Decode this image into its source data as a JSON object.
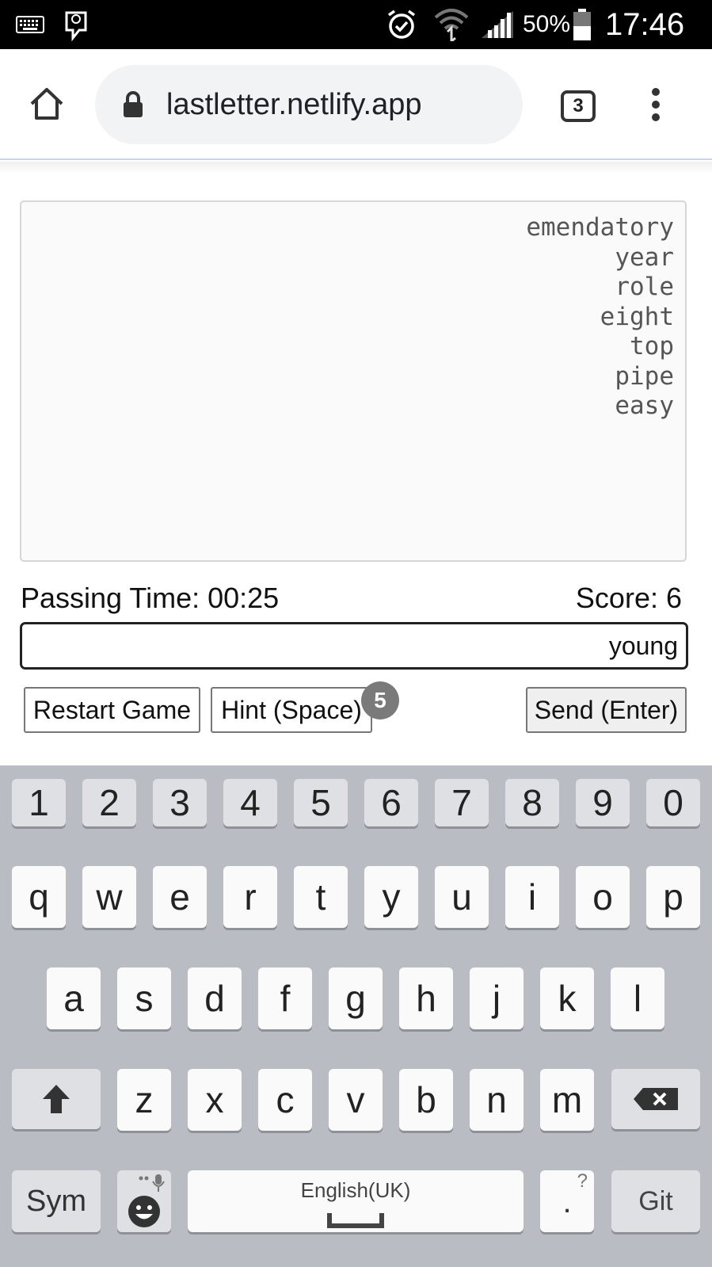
{
  "status_bar": {
    "battery": "50%",
    "time": "17:46",
    "icons": [
      "keyboard-icon",
      "notification-icon",
      "alarm-icon",
      "wifi-icon",
      "signal-icon",
      "battery-icon"
    ]
  },
  "browser": {
    "url": "lastletter.netlify.app",
    "tab_count": "3",
    "icons": [
      "home-icon",
      "lock-icon",
      "menu-icon"
    ]
  },
  "game": {
    "words": [
      "emendatory",
      "year",
      "role",
      "eight",
      "top",
      "pipe",
      "easy"
    ],
    "passing_time": "Passing Time: 00:25",
    "score": "Score: 6",
    "input_value": "young",
    "buttons": {
      "restart": "Restart Game",
      "hint": "Hint (Space)",
      "hint_count": "5",
      "send": "Send (Enter)"
    }
  },
  "keyboard": {
    "row_numbers": [
      "1",
      "2",
      "3",
      "4",
      "5",
      "6",
      "7",
      "8",
      "9",
      "0"
    ],
    "row_1": [
      "q",
      "w",
      "e",
      "r",
      "t",
      "y",
      "u",
      "i",
      "o",
      "p"
    ],
    "row_2": [
      "a",
      "s",
      "d",
      "f",
      "g",
      "h",
      "j",
      "k",
      "l"
    ],
    "row_3": [
      "z",
      "x",
      "c",
      "v",
      "b",
      "n",
      "m"
    ],
    "sym": "Sym",
    "space_label": "English(UK)",
    "period": ".",
    "period_hint": "?",
    "go": "Git",
    "icons": [
      "shift-icon",
      "backspace-icon",
      "emoji-icon",
      "mic-icon",
      "space-icon"
    ]
  }
}
